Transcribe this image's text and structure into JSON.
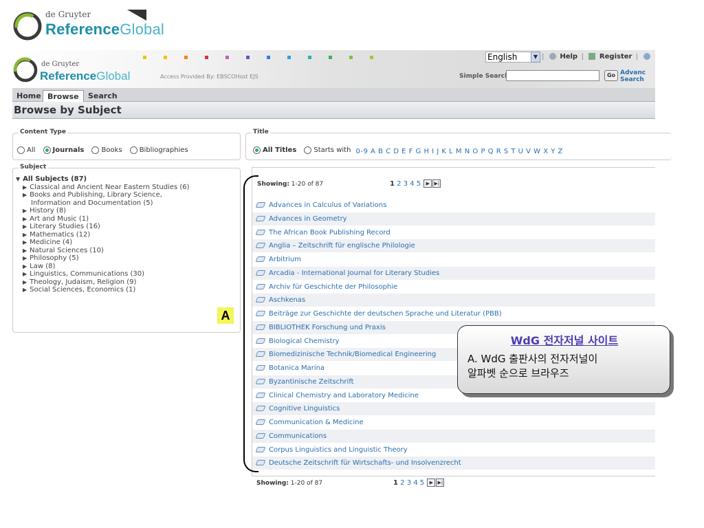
{
  "top_logo": {
    "publisher": "de Gruyter",
    "brand_bold": "Reference",
    "brand_light": "Global"
  },
  "header": {
    "publisher": "de Gruyter",
    "brand_bold": "Reference",
    "brand_light": "Global",
    "access_text": "Access Provided By: EBSCOHost EJS",
    "language": "English",
    "help": "Help",
    "register": "Register",
    "simple_search_label": "Simple Search",
    "go_label": "Go",
    "advanced_line1": "Advanc",
    "advanced_line2": "Search"
  },
  "tabs": [
    {
      "label": "Home",
      "active": false
    },
    {
      "label": "Browse",
      "active": true
    },
    {
      "label": "Search",
      "active": false
    }
  ],
  "page_title": "Browse by Subject",
  "content_type": {
    "legend": "Content Type",
    "options": [
      "All",
      "Journals",
      "Books",
      "Bibliographies"
    ],
    "selected": "Journals"
  },
  "title_filter": {
    "legend": "Title",
    "all_titles": "All Titles",
    "starts_with": "Starts with",
    "letters": "0-9 A B C D E F G H I J K L M N O P Q R S T U V W X Y Z"
  },
  "subject": {
    "legend": "Subject",
    "root": "All Subjects (87)",
    "items": [
      "Classical and Ancient Near Eastern Studies (6)",
      "Books and Publishing, Library Science,",
      "Information and Documentation (5)",
      "History (8)",
      "Art and Music (1)",
      "Literary Studies (16)",
      "Mathematics (12)",
      "Medicine (4)",
      "Natural Sciences (10)",
      "Philosophy (5)",
      "Law (8)",
      "Linguistics, Communications (30)",
      "Theology, Judaism, Religion (9)",
      "Social Sciences, Economics (1)"
    ]
  },
  "badge": "A",
  "results": {
    "showing_label": "Showing:",
    "showing_range": "1-20 of 87",
    "current_page": "1",
    "pages": "2 3 4 5",
    "items": [
      "Advances in Calculus of Variations",
      "Advances in Geometry",
      "The African Book Publishing Record",
      "Anglia – Zeitschrift für englische Philologie",
      "Arbitrium",
      "Arcadia - International Journal for Literary Studies",
      "Archiv für Geschichte der Philosophie",
      "Aschkenas",
      "Beiträge zur Geschichte der deutschen Sprache und Literatur (PBB)",
      "BIBLIOTHEK Forschung und Praxis",
      "Biological Chemistry",
      "Biomedizinische Technik/Biomedical Engineering",
      "Botanica Marina",
      "Byzantinische Zeitschrift",
      "Clinical Chemistry and Laboratory Medicine",
      "Cognitive Linguistics",
      "Communication & Medicine",
      "Communications",
      "Corpus Linguistics and Linguistic Theory",
      "Deutsche Zeitschrift für Wirtschafts- und Insolvenzrecht"
    ]
  },
  "callout": {
    "title": "WdG 전자저널 사이트",
    "line1": "A. WdG 출판사의 전자저널이",
    "line2": "알파벳 순으로 브라우즈"
  },
  "colors": {
    "brand": "#1e8fa8",
    "link": "#2a6fb0",
    "callout_title": "#4b3db0",
    "badge": "#f3f55a"
  }
}
